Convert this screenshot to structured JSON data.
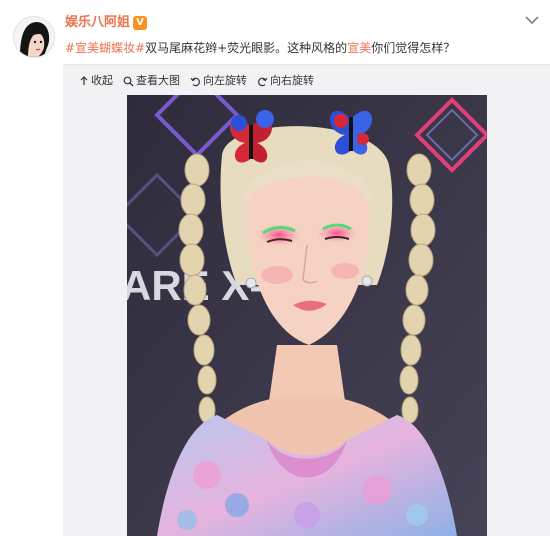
{
  "author": {
    "name": "娱乐八阿姐",
    "badge": "V"
  },
  "post": {
    "segments": [
      {
        "type": "hashtag",
        "text": "#宣美蝴蝶妆#"
      },
      {
        "type": "text",
        "text": "双马尾麻花辫+荧光眼影。这种风格的"
      },
      {
        "type": "hashtag",
        "text": "宣美"
      },
      {
        "type": "text",
        "text": "你们觉得怎样？"
      }
    ]
  },
  "toolbar": {
    "items": [
      {
        "label": "收起",
        "icon": "collapse-arrow-icon"
      },
      {
        "label": "查看大图",
        "icon": "magnifier-icon"
      },
      {
        "label": "向左旋转",
        "icon": "rotate-left-icon"
      },
      {
        "label": "向右旋转",
        "icon": "rotate-right-icon"
      }
    ]
  },
  "photo": {
    "backdrop_text": "ARE X-1",
    "colors": {
      "backdrop": "#3a3747",
      "accent_pink": "#e0407a",
      "hair": "#e8dcc0"
    }
  },
  "colors": {
    "link": "#eb7350",
    "badge": "#f7931e"
  }
}
